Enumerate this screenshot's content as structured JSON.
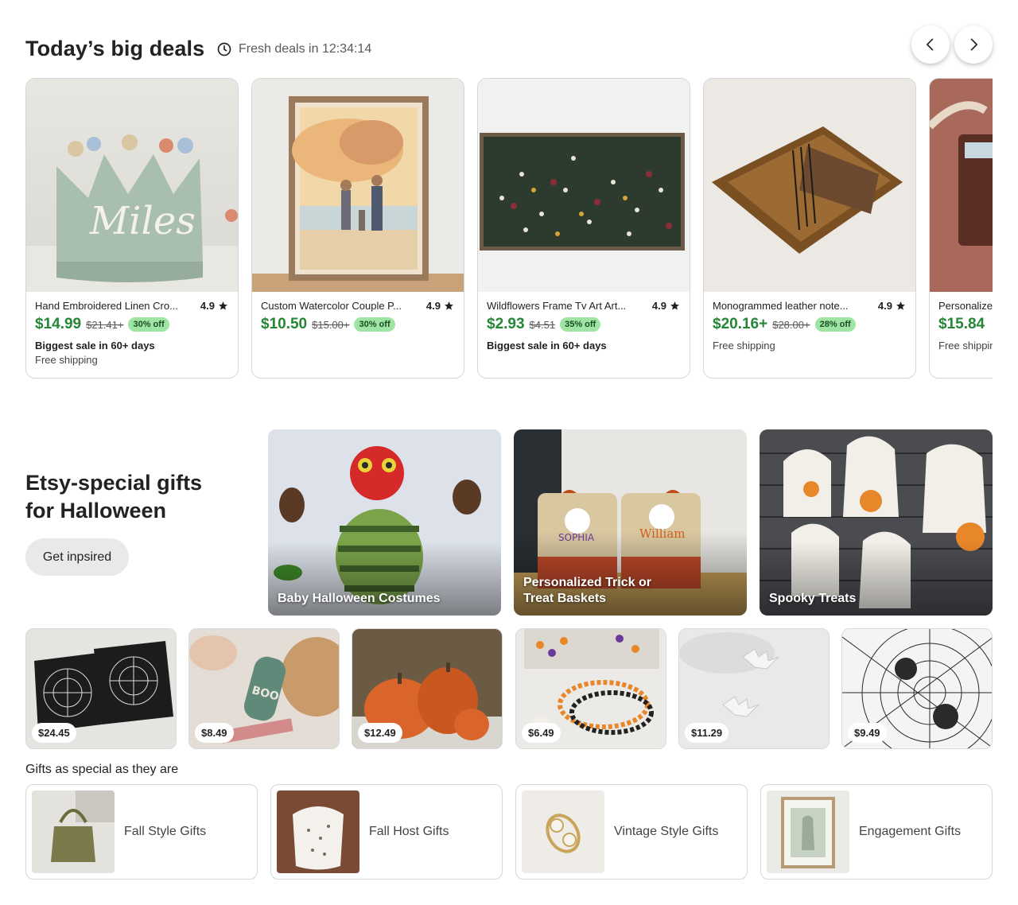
{
  "deals": {
    "title": "Today’s big deals",
    "timer_text": "Fresh deals in 12:34:14",
    "prev_label": "Previous",
    "next_label": "Next",
    "items": [
      {
        "name": "Hand Embroidered Linen Cro...",
        "rating": "4.9",
        "price": "$14.99",
        "old_price": "$21.41+",
        "discount": "30% off",
        "note_bold": "Biggest sale in 60+ days",
        "note": "Free shipping"
      },
      {
        "name": "Custom Watercolor Couple P...",
        "rating": "4.9",
        "price": "$10.50",
        "old_price": "$15.00+",
        "discount": "30% off",
        "note_bold": "",
        "note": ""
      },
      {
        "name": "Wildflowers Frame Tv Art Art...",
        "rating": "4.9",
        "price": "$2.93",
        "old_price": "$4.51",
        "discount": "35% off",
        "note_bold": "Biggest sale in 60+ days",
        "note": ""
      },
      {
        "name": "Monogrammed leather note...",
        "rating": "4.9",
        "price": "$20.16+",
        "old_price": "$28.00+",
        "discount": "28% off",
        "note_bold": "",
        "note": "Free shipping"
      },
      {
        "name": "Personalized",
        "rating": "",
        "price": "$15.84",
        "old_price": "",
        "discount": "",
        "note_bold": "",
        "note": "Free shipping"
      }
    ]
  },
  "halloween": {
    "title_line1": "Etsy-special gifts",
    "title_line2": "for Halloween",
    "button_label": "Get inpsired",
    "tiles": [
      {
        "label_line1": "Baby Halloween Costumes",
        "label_line2": ""
      },
      {
        "label_line1": "Personalized Trick or",
        "label_line2": "Treat Baskets"
      },
      {
        "label_line1": "Spooky Treats",
        "label_line2": ""
      }
    ],
    "mini": [
      {
        "price": "$24.45"
      },
      {
        "price": "$8.49"
      },
      {
        "price": "$12.49"
      },
      {
        "price": "$6.49"
      },
      {
        "price": "$11.29"
      },
      {
        "price": "$9.49"
      }
    ]
  },
  "gifts": {
    "caption": "Gifts as special as they are",
    "items": [
      {
        "label": "Fall Style Gifts"
      },
      {
        "label": "Fall Host Gifts"
      },
      {
        "label": "Vintage Style Gifts"
      },
      {
        "label": "Engagement Gifts"
      }
    ]
  },
  "colors": {
    "sale_green": "#258635",
    "discount_bg": "#9ee5a3",
    "button_bg": "#e9e9e9"
  }
}
